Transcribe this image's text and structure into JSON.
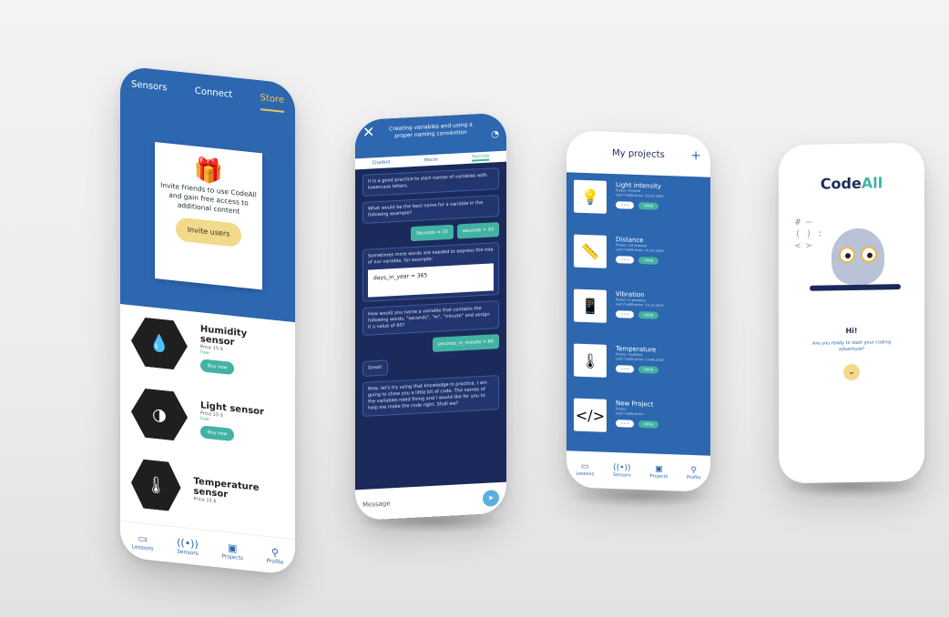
{
  "phone1": {
    "tabs": [
      "Sensors",
      "Connect",
      "Store"
    ],
    "invite_text": "Invite friends to use CodeAll and gain free access to additional content",
    "invite_button": "Invite users",
    "sensors": [
      {
        "name": "Humidity sensor",
        "price": "Price 15 $",
        "free": "free",
        "buy": "Buy now"
      },
      {
        "name": "Light sensor",
        "price": "Price 15 $",
        "free": "free",
        "buy": "Buy now"
      },
      {
        "name": "Temperature sensor",
        "price": "Price 15 $",
        "free": "",
        "buy": ""
      }
    ],
    "nav": [
      "Lessons",
      "Sensors",
      "Projects",
      "Profile"
    ]
  },
  "phone2": {
    "title": "Creating variables and using a proper naming convention",
    "tabs": [
      "Chatbot",
      "Macro",
      "Remote"
    ],
    "messages": [
      "It is a good practice to start names of variables with lowercase letters.",
      "What would be the best name for a variable in the following example?",
      "Sometimes more words are needed to express the role of our variable, for example:",
      "How would you name a variable that contains the following words: \"seconds\", \"in\", \"minute\" and assign it a value of 60?",
      "Great!",
      "Now, let's try using that knowledge in practice. I am going to show you a little bit of code. The names of the variables need fixing and I would like for you to help me make the code right. Shall we?"
    ],
    "answers": [
      "Seconds = 33",
      "seconds = 33"
    ],
    "code": "days_in_year = 365",
    "reply": "seconds_in_minute = 60",
    "input_placeholder": "Message"
  },
  "phone3": {
    "title": "My projects",
    "projects": [
      {
        "name": "Light intensity",
        "status": "Status: finished",
        "date": "Last modification: 16.03.2020",
        "icon": "bulb-icon"
      },
      {
        "name": "Distance",
        "status": "Status: not finished",
        "date": "Last modification: 01.03.2020",
        "icon": "ruler-icon"
      },
      {
        "name": "Vibration",
        "status": "Status: in progress",
        "date": "Last modification: 19.12.2019",
        "icon": "phone-icon"
      },
      {
        "name": "Temperature",
        "status": "Status: modified",
        "date": "Last modification: 14.08.2018",
        "icon": "thermometer-icon"
      },
      {
        "name": "New Project",
        "status": "Status: -",
        "date": "Last modification: -",
        "icon": "code-icon"
      }
    ],
    "edit_label": "• • •",
    "open_label": "OPEN",
    "nav": [
      "Lessons",
      "Sensors",
      "Projects",
      "Profile"
    ]
  },
  "phone4": {
    "logo_code": "Code",
    "logo_all": "All",
    "code_symbols": [
      "# —",
      "( ) :",
      "< >"
    ],
    "greeting": "Hi!",
    "subtitle": "Are you ready to start your coding adventure?"
  }
}
